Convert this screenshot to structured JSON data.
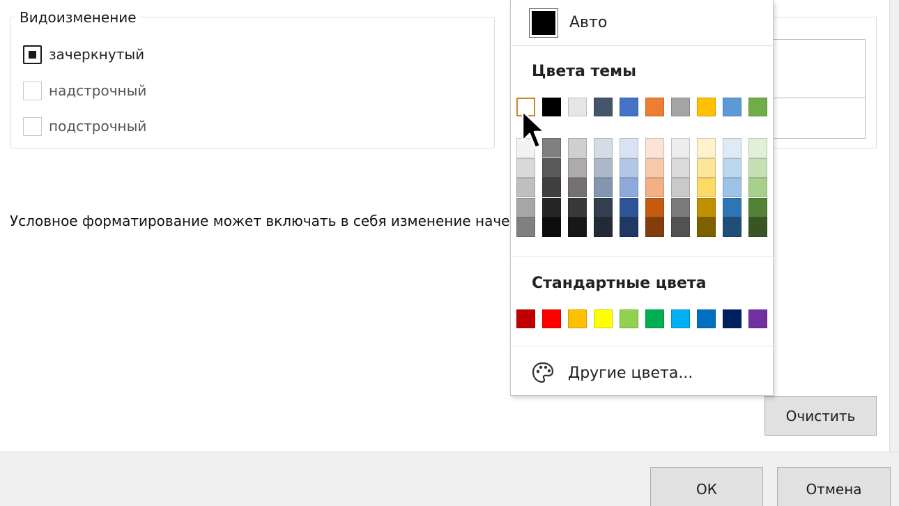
{
  "effects": {
    "legend": "Видоизменение",
    "options": [
      {
        "label": "зачеркнутый",
        "checked": true,
        "enabled": true
      },
      {
        "label": "надстрочный",
        "checked": false,
        "enabled": false
      },
      {
        "label": "подстрочный",
        "checked": false,
        "enabled": false
      }
    ]
  },
  "info_text": "Условное форматирование может включать в себя изменение наче",
  "palette": {
    "auto_label": "Авто",
    "theme_title": "Цвета темы",
    "standard_title": "Стандартные цвета",
    "more_label": "Другие цвета...",
    "theme_colors": [
      "#ffffff",
      "#000000",
      "#e7e6e6",
      "#44546a",
      "#4472c4",
      "#ed7d31",
      "#a5a5a5",
      "#ffc000",
      "#5b9bd5",
      "#70ad47"
    ],
    "theme_shades": [
      [
        "#f2f2f2",
        "#d9d9d9",
        "#bfbfbf",
        "#a6a6a6",
        "#808080"
      ],
      [
        "#808080",
        "#595959",
        "#404040",
        "#262626",
        "#0d0d0d"
      ],
      [
        "#d0cece",
        "#aeaaaa",
        "#757171",
        "#3a3838",
        "#171717"
      ],
      [
        "#d6dce4",
        "#adb9ca",
        "#8497b0",
        "#333f4f",
        "#222a35"
      ],
      [
        "#d9e2f3",
        "#b4c6e7",
        "#8eaadb",
        "#2f5496",
        "#1f3864"
      ],
      [
        "#fbe4d5",
        "#f7caac",
        "#f4b083",
        "#c55a11",
        "#833c0b"
      ],
      [
        "#ededed",
        "#dbdbdb",
        "#c9c9c9",
        "#7b7b7b",
        "#525252"
      ],
      [
        "#fff2cc",
        "#fee599",
        "#ffd965",
        "#bf9000",
        "#7f6000"
      ],
      [
        "#deeaf6",
        "#bdd7ee",
        "#9cc3e5",
        "#2e75b5",
        "#1f4e79"
      ],
      [
        "#e2efd9",
        "#c5e0b3",
        "#a8d08d",
        "#538135",
        "#375623"
      ]
    ],
    "standard_colors": [
      "#c00000",
      "#ff0000",
      "#ffc000",
      "#ffff00",
      "#92d050",
      "#00b050",
      "#00b0f0",
      "#0070c0",
      "#002060",
      "#7030a0"
    ],
    "selected_theme_index": 0
  },
  "buttons": {
    "clear": "Очистить",
    "ok": "ОК",
    "cancel": "Отмена"
  },
  "icons": {
    "more_colors": "palette-icon",
    "cursor": "mouse-pointer-icon"
  }
}
